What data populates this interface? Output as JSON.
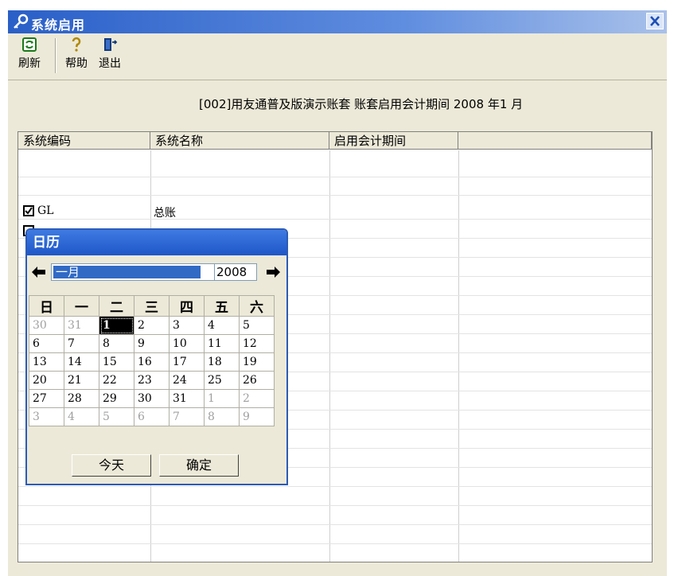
{
  "window": {
    "title": "系统启用"
  },
  "toolbar": {
    "refresh": "刷新",
    "help": "帮助",
    "exit": "退出"
  },
  "period": {
    "text": "[002]用友通普及版演示账套 账套启用会计期间 2008 年1 月"
  },
  "grid": {
    "headers": [
      "系统编码",
      "系统名称",
      "启用会计期间"
    ],
    "rows": [
      {
        "code": "GL",
        "name": "总账",
        "checked": true,
        "period": ""
      },
      {
        "code": "",
        "name": "",
        "checked": false,
        "period": ""
      }
    ]
  },
  "calendar": {
    "title": "日历",
    "month": "一月",
    "year": "2008",
    "weekdays": [
      "日",
      "一",
      "二",
      "三",
      "四",
      "五",
      "六"
    ],
    "weeks": [
      [
        "30",
        "31",
        "1",
        "2",
        "3",
        "4",
        "5"
      ],
      [
        "6",
        "7",
        "8",
        "9",
        "10",
        "11",
        "12"
      ],
      [
        "13",
        "14",
        "15",
        "16",
        "17",
        "18",
        "19"
      ],
      [
        "20",
        "21",
        "22",
        "23",
        "24",
        "25",
        "26"
      ],
      [
        "27",
        "28",
        "29",
        "30",
        "31",
        "1",
        "2"
      ],
      [
        "3",
        "4",
        "5",
        "6",
        "7",
        "8",
        "9"
      ]
    ],
    "selected_day": "1",
    "today_button": "今天",
    "ok_button": "确定"
  },
  "colors": {
    "titlebar": "#2a5fc8",
    "selection": "#316ac5",
    "face": "#ece9d8"
  }
}
